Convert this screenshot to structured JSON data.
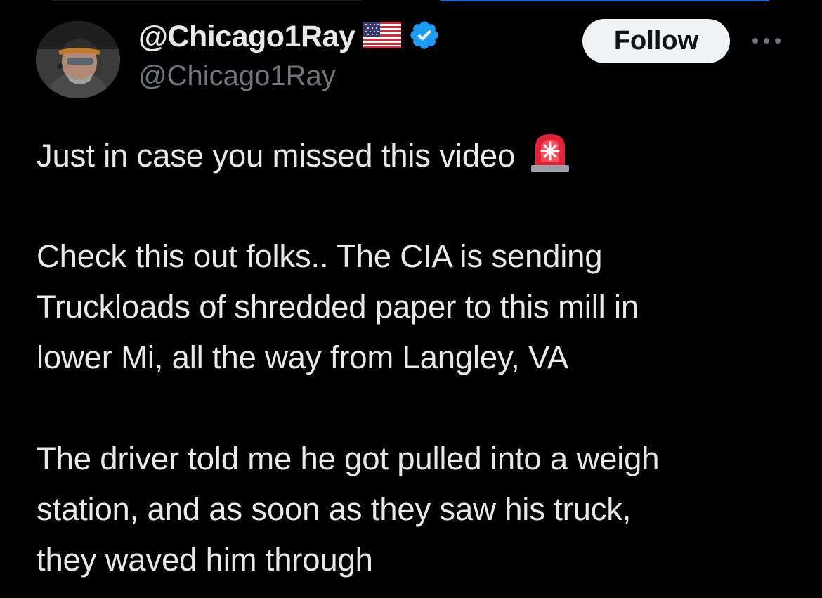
{
  "author": {
    "display_name": "@Chicago1Ray",
    "handle": "@Chicago1Ray",
    "verified": true,
    "flag_icon": "us-flag-icon",
    "verified_icon": "verified-badge-icon"
  },
  "actions": {
    "follow_label": "Follow",
    "more_icon": "more-options-icon"
  },
  "tweet": {
    "line_1": "Just in case you missed this video",
    "line_1_icon": "rotating-light-siren-icon",
    "paragraph_2": {
      "line_1": "Check this out folks.. The CIA is sending",
      "line_2": "Truckloads of shredded paper to this mill in",
      "line_3": "lower Mi, all the way from Langley, VA"
    },
    "paragraph_3": {
      "line_1": "The driver told me he got pulled into a weigh",
      "line_2": "station, and as soon as they saw his truck,",
      "line_3": "they waved him through"
    }
  },
  "colors": {
    "background": "#000000",
    "text_primary": "#e7e9ea",
    "text_secondary": "#71767b",
    "verified_blue": "#1d9bf0",
    "follow_button_bg": "#eff3f4"
  }
}
